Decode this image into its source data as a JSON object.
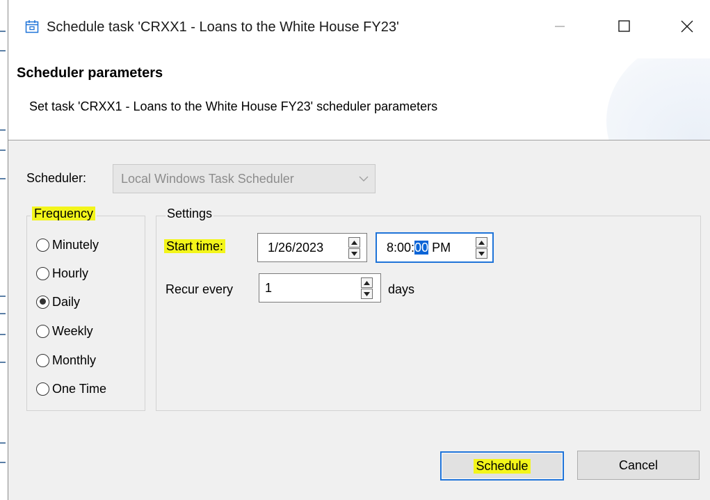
{
  "window": {
    "title": "Schedule task 'CRXX1 - Loans to the White House FY23'",
    "controls": {
      "minimize": "minimize-icon",
      "maximize": "maximize-icon",
      "close": "close-icon"
    }
  },
  "header": {
    "title": "Scheduler parameters",
    "description": "Set task 'CRXX1 - Loans to the White House FY23' scheduler parameters"
  },
  "scheduler": {
    "label": "Scheduler:",
    "value": "Local Windows Task Scheduler",
    "enabled": false
  },
  "frequency": {
    "label": "Frequency",
    "options": [
      "Minutely",
      "Hourly",
      "Daily",
      "Weekly",
      "Monthly",
      "One Time"
    ],
    "selected": "Daily"
  },
  "settings": {
    "label": "Settings",
    "start_time_label": "Start time:",
    "start_date": "1/26/2023",
    "start_time_prefix": "8:00:",
    "start_time_selected": "00",
    "start_time_suffix": "PM",
    "recur_label": "Recur every",
    "recur_value": "1",
    "recur_unit": "days"
  },
  "buttons": {
    "schedule": "Schedule",
    "cancel": "Cancel"
  },
  "colors": {
    "highlight": "#f3f51a",
    "focus_border": "#1e73d8",
    "selection": "#0a64d6"
  }
}
